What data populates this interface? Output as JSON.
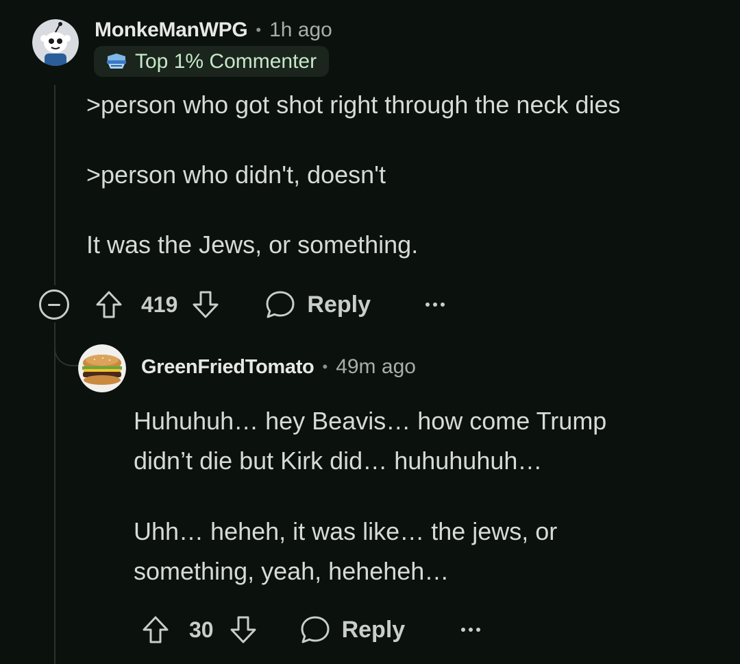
{
  "thread": {
    "parent": {
      "username": "MonkeManWPG",
      "time": "1h ago",
      "avatar_icon": "snoo-avatar-icon",
      "badge": {
        "icon": "shield-badge-icon",
        "label": "Top 1% Commenter"
      },
      "body": [
        ">person who got shot right through the neck dies",
        ">person who didn't, doesn't",
        "It was the Jews, or something."
      ],
      "votes": "419",
      "reply_label": "Reply"
    },
    "reply": {
      "username": "GreenFriedTomato",
      "time": "49m ago",
      "avatar_icon": "burger-avatar-icon",
      "body_lines": [
        "Huhuhuh… hey Beavis… how come Trump",
        "didn’t die but Kirk did… huhuhuhuh…",
        "Uhh… heheh, it was like… the jews, or",
        "something, yeah, heheheh…"
      ],
      "votes": "30",
      "reply_label": "Reply"
    }
  },
  "colors": {
    "background": "#0b110d",
    "text": "#d6dbd8",
    "muted": "#a6b0a8",
    "badge_bg": "#1b241d",
    "badge_text": "#c6e9c9",
    "thread_line": "#2c332e"
  }
}
